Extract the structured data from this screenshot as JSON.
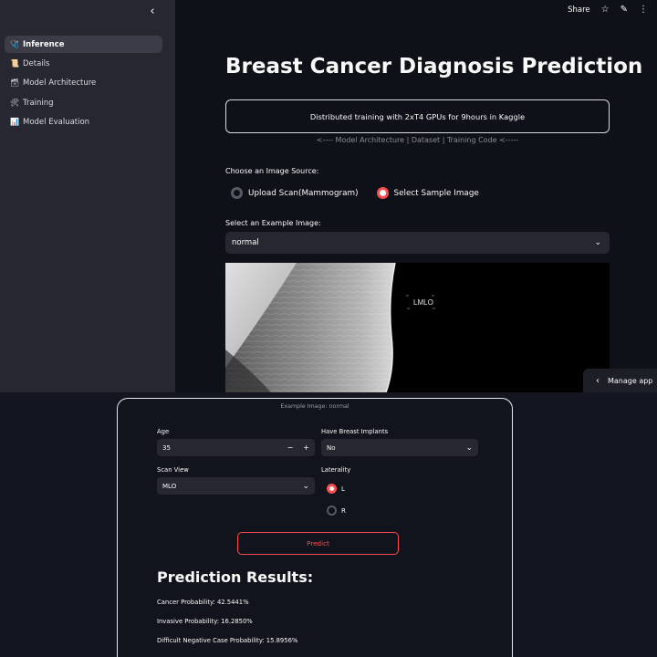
{
  "sidebar": {
    "items": [
      {
        "label": "Inference",
        "icon": "🩺"
      },
      {
        "label": "Details",
        "icon": "📜"
      },
      {
        "label": "Model Architecture",
        "icon": "🗃"
      },
      {
        "label": "Training",
        "icon": "🛠"
      },
      {
        "label": "Model Evaluation",
        "icon": "📊"
      }
    ],
    "collapse_icon": "‹"
  },
  "toolbar": {
    "share_label": "Share"
  },
  "main": {
    "title": "Breast Cancer Diagnosis Prediction",
    "info_box": "Distributed training with 2xT4 GPUs for 9hours in Kaggle",
    "links": "<---- Model Architecture | Dataset | Training Code <-----",
    "source_label": "Choose an Image Source:",
    "source_options": [
      "Upload Scan(Mammogram)",
      "Select Sample Image"
    ],
    "source_selected": "Select Sample Image",
    "example_label": "Select an Example Image:",
    "example_value": "normal",
    "image_tag": "LMLO"
  },
  "manage_app": "Manage app",
  "form": {
    "caption": "Example Image: normal",
    "age_label": "Age",
    "age_value": "35",
    "implants_label": "Have Breast Implants",
    "implants_value": "No",
    "scanview_label": "Scan View",
    "scanview_value": "MLO",
    "laterality_label": "Laterality",
    "laterality_options": [
      "L",
      "R"
    ],
    "laterality_selected": "L",
    "predict_label": "Predict"
  },
  "results": {
    "title": "Prediction Results:",
    "lines": [
      "Cancer Probability: 42.5441%",
      "Invasive Probability: 16.2850%",
      "Difficult Negative Case Probability: 15.8956%"
    ]
  },
  "colors": {
    "accent": "#ff4b4b",
    "background": "#0e1117",
    "sidebar": "#262730"
  }
}
